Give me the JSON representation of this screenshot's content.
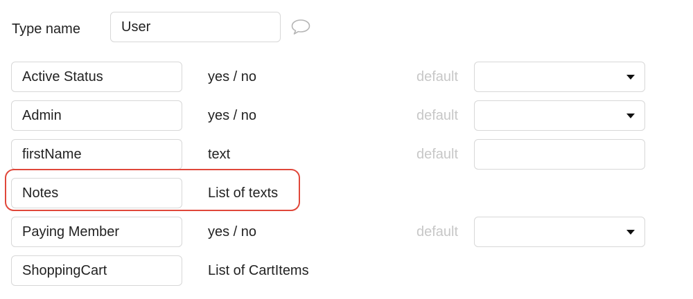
{
  "type_name": {
    "label": "Type name",
    "value": "User"
  },
  "fields": [
    {
      "name": "Active Status",
      "type": "yes / no",
      "default_label": "default",
      "default_value": "",
      "has_default": true,
      "has_dropdown": true
    },
    {
      "name": "Admin",
      "type": "yes / no",
      "default_label": "default",
      "default_value": "",
      "has_default": true,
      "has_dropdown": true
    },
    {
      "name": "firstName",
      "type": "text",
      "default_label": "default",
      "default_value": "",
      "has_default": true,
      "has_dropdown": false
    },
    {
      "name": "Notes",
      "type": "List of texts",
      "has_default": false,
      "has_dropdown": false,
      "highlighted": true
    },
    {
      "name": "Paying Member",
      "type": "yes / no",
      "default_label": "default",
      "default_value": "",
      "has_default": true,
      "has_dropdown": true
    },
    {
      "name": "ShoppingCart",
      "type": "List of CartItems",
      "has_default": false,
      "has_dropdown": false
    }
  ],
  "icons": {
    "comment": "speech-bubble-icon",
    "dropdown": "caret-down-icon"
  },
  "colors": {
    "highlight": "#e0473a",
    "border": "#d7d7d7",
    "default_label": "#c7c7c7"
  }
}
